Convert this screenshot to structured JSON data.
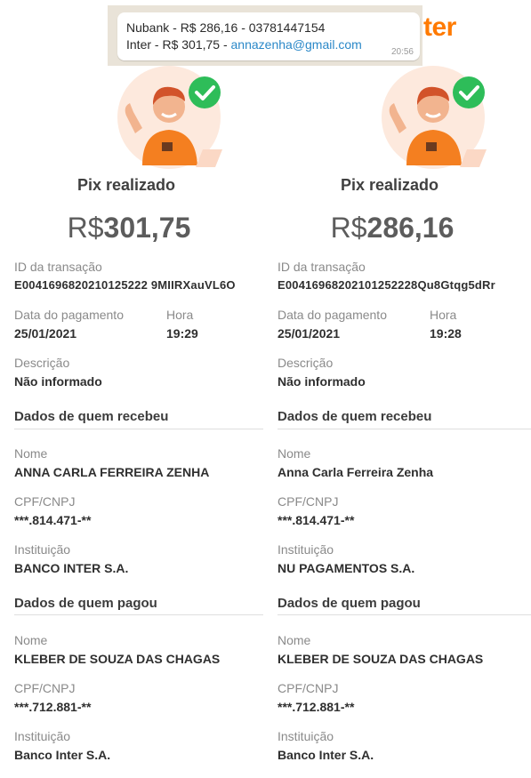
{
  "notification": {
    "line1": "Nubank - R$ 286,16 - 03781447154",
    "line2_prefix": "Inter - R$ 301,75 - ",
    "line2_email": "annazenha@gmail.com",
    "time": "20:56"
  },
  "logo_fragment": "ter",
  "labels": {
    "pix_title": "Pix realizado",
    "currency": "R$",
    "transaction_id": "ID da transação",
    "payment_date": "Data do pagamento",
    "time": "Hora",
    "description": "Descrição",
    "receiver_section": "Dados de quem recebeu",
    "payer_section": "Dados de quem pagou",
    "name": "Nome",
    "cpf_cnpj": "CPF/CNPJ",
    "institution": "Instituição"
  },
  "receipts": [
    {
      "amount": "301,75",
      "transaction_id": "E0041696820210125222 9MIIRXauVL6O",
      "date": "25/01/2021",
      "time": "19:29",
      "description": "Não informado",
      "receiver": {
        "name": "ANNA CARLA FERREIRA ZENHA",
        "cpf": "***.814.471-**",
        "institution": "BANCO INTER S.A."
      },
      "payer": {
        "name": "KLEBER DE SOUZA DAS CHAGAS",
        "cpf": "***.712.881-**",
        "institution": "Banco Inter S.A."
      }
    },
    {
      "amount": "286,16",
      "transaction_id": "E00416968202101252228Qu8Gtqg5dRr",
      "date": "25/01/2021",
      "time": "19:28",
      "description": "Não informado",
      "receiver": {
        "name": "Anna Carla Ferreira Zenha",
        "cpf": "***.814.471-**",
        "institution": "NU PAGAMENTOS S.A."
      },
      "payer": {
        "name": "KLEBER DE SOUZA DAS CHAGAS",
        "cpf": "***.712.881-**",
        "institution": "Banco Inter S.A."
      }
    }
  ],
  "colors": {
    "accent": "#ff7a00",
    "check": "#2ebd59",
    "link": "#2a88c8"
  }
}
